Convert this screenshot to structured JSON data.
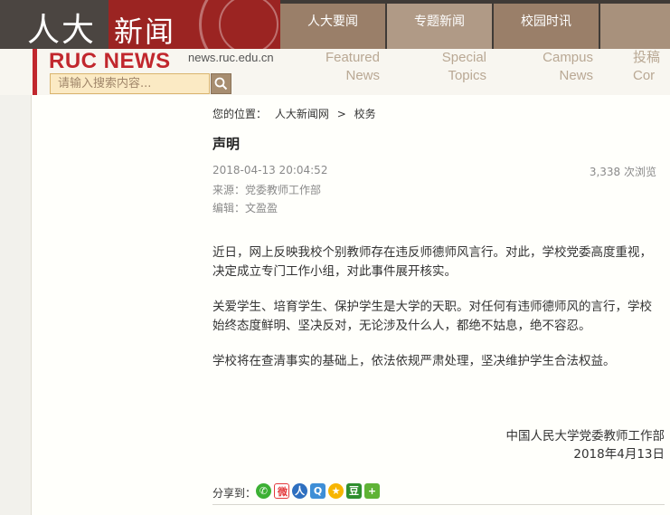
{
  "header": {
    "logo_cn_a": "人大",
    "logo_cn_b": "新闻",
    "nav": [
      "人大要闻",
      "专题新闻",
      "校园时讯",
      ""
    ],
    "brand": "RUC NEWS",
    "url": "news.ruc.edu.cn",
    "search_placeholder": "请输入搜索内容...",
    "en_tabs": [
      {
        "line1": "Featured",
        "line2": "News"
      },
      {
        "line1": "Special",
        "line2": "Topics"
      },
      {
        "line1": "Campus",
        "line2": "News"
      },
      {
        "line1": "投稿",
        "line2": "Cor"
      }
    ]
  },
  "breadcrumb": {
    "prefix": "您的位置：",
    "home": "人大新闻网",
    "sep": ">",
    "section": "校务"
  },
  "article": {
    "title": "声明",
    "datetime": "2018-04-13 20:04:52",
    "views": "3,338 次浏览",
    "source": "来源：党委教师工作部",
    "editor": "编辑：文盈盈",
    "paragraphs": [
      "近日，网上反映我校个别教师存在违反师德师风言行。对此，学校党委高度重视，决定成立专门工作小组，对此事件展开核实。",
      "关爱学生、培育学生、保护学生是大学的天职。对任何有违师德师风的言行，学校始终态度鲜明、坚决反对，无论涉及什么人，都绝不姑息，绝不容忍。",
      "学校将在查清事实的基础上，依法依规严肃处理，坚决维护学生合法权益。"
    ],
    "signature": "中国人民大学党委教师工作部",
    "date": "2018年4月13日"
  },
  "share": {
    "label": "分享到：",
    "icons": [
      {
        "name": "wechat-icon",
        "glyph": "✆"
      },
      {
        "name": "weibo-icon",
        "glyph": "微"
      },
      {
        "name": "renren-icon",
        "glyph": "人"
      },
      {
        "name": "qzone-icon",
        "glyph": "Q"
      },
      {
        "name": "tencent-weibo-icon",
        "glyph": "★"
      },
      {
        "name": "douban-icon",
        "glyph": "豆"
      },
      {
        "name": "more-share-icon",
        "glyph": "+"
      }
    ]
  },
  "colors": {
    "brand_red": "#c1272d",
    "nav_brown": "#9a7f69",
    "search_bg": "#fbeac4"
  }
}
